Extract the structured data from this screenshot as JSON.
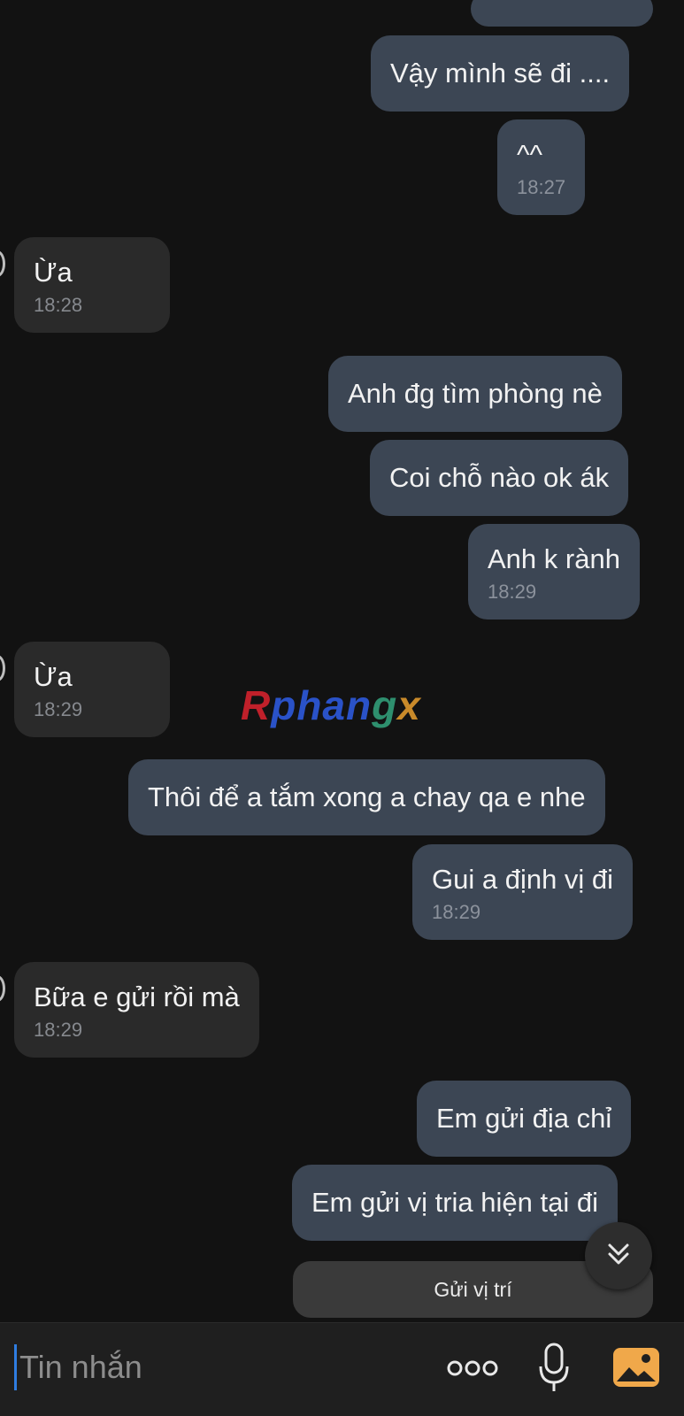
{
  "messages": [
    {
      "text": "Vậy mình sẽ đi ...."
    },
    {
      "text": "^^",
      "time": "18:27"
    },
    {
      "text": "Ừa",
      "time": "18:28"
    },
    {
      "text": "Anh đg tìm phòng nè"
    },
    {
      "text": "Coi chỗ nào ok ák"
    },
    {
      "text": "Anh k rành",
      "time": "18:29"
    },
    {
      "text": "Ừa",
      "time": "18:29"
    },
    {
      "text": "Thôi để a tắm xong a chay qa e nhe"
    },
    {
      "text": "Gui a định vị đi",
      "time": "18:29"
    },
    {
      "text": "Bữa e gửi rồi mà",
      "time": "18:29"
    },
    {
      "text": "Em gửi địa chỉ"
    },
    {
      "text": "Em gửi vị tria hiện tại đi"
    }
  ],
  "watermark": {
    "p1": "R",
    "p2": "phan",
    "p3": "g",
    "p4": "x"
  },
  "send_location_label": "Gửi vị trí",
  "composer": {
    "placeholder": "Tin nhắn"
  },
  "icons": {
    "scroll_down": "double-chevron-down-icon",
    "more": "more-dots-icon",
    "mic": "microphone-icon",
    "gallery": "image-gallery-icon"
  },
  "colors": {
    "outgoing_bubble": "#3c4654",
    "incoming_bubble": "#2a2a2a",
    "background": "#121212",
    "accent": "#2f7de1",
    "gallery_icon": "#f0a84a"
  }
}
